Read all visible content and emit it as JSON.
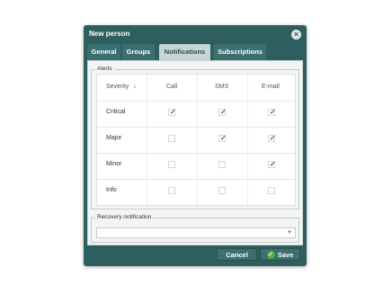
{
  "dialog": {
    "title": "New person",
    "close_icon": "close-icon"
  },
  "tabs": [
    {
      "label": "General",
      "active": false
    },
    {
      "label": "Groups",
      "active": false
    },
    {
      "label": "Notifications",
      "active": true
    },
    {
      "label": "Subscriptions",
      "active": false
    }
  ],
  "alerts": {
    "legend": "Alerts",
    "columns": {
      "severity": "Severity",
      "sort_icon": "arrow-down-icon",
      "call": "Call",
      "sms": "SMS",
      "email": "E-mail"
    },
    "rows": [
      {
        "label": "Critical",
        "call": true,
        "sms": true,
        "email": true
      },
      {
        "label": "Major",
        "call": false,
        "sms": true,
        "email": true
      },
      {
        "label": "Minor",
        "call": false,
        "sms": false,
        "email": true
      },
      {
        "label": "Info",
        "call": false,
        "sms": false,
        "email": false
      }
    ]
  },
  "recovery": {
    "legend": "Recovery notification",
    "value": ""
  },
  "buttons": {
    "cancel": "Cancel",
    "save": "Save"
  }
}
